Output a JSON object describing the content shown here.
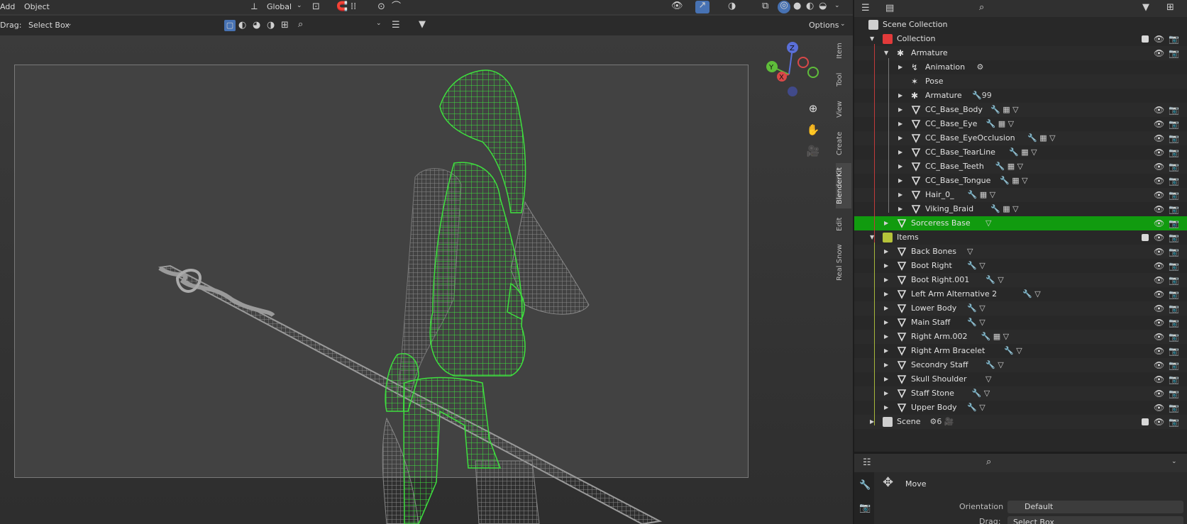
{
  "viewport": {
    "menu": [
      "Add",
      "Object"
    ],
    "orientation": "Global",
    "drag_label": "Drag:",
    "select_mode": "Select Box",
    "options_label": "Options",
    "side_tabs": [
      "Item",
      "Tool",
      "View",
      "Create",
      "BlenderKit",
      "Edit",
      "Real Snow"
    ],
    "active_side_tab": "BlenderKit",
    "gizmo": {
      "x": "X",
      "y": "Y",
      "z": "Z"
    }
  },
  "outliner": {
    "scene_collection": "Scene Collection",
    "rows": [
      {
        "label": "Collection",
        "type": "collection",
        "indent": 1,
        "expanded": true,
        "check": true,
        "eye": true,
        "cam": true,
        "color": "#e23a3a"
      },
      {
        "label": "Armature",
        "type": "armature",
        "indent": 2,
        "expanded": true,
        "eye": true,
        "cam": true
      },
      {
        "label": "Animation",
        "type": "anim",
        "indent": 3,
        "collapsed": true,
        "extra": "⚙"
      },
      {
        "label": "Pose",
        "type": "pose",
        "indent": 3
      },
      {
        "label": "Armature",
        "type": "bone",
        "indent": 3,
        "collapsed": true,
        "extra": "🔧99"
      },
      {
        "label": "CC_Base_Body",
        "type": "mesh",
        "indent": 3,
        "collapsed": true,
        "extra": "🔧 ▦ ▽",
        "eye": true,
        "cam": true
      },
      {
        "label": "CC_Base_Eye",
        "type": "mesh",
        "indent": 3,
        "collapsed": true,
        "extra": "🔧 ▦ ▽",
        "eye": true,
        "cam": true
      },
      {
        "label": "CC_Base_EyeOcclusion",
        "type": "mesh",
        "indent": 3,
        "collapsed": true,
        "extra": "🔧 ▦ ▽",
        "eye": true,
        "cam": true
      },
      {
        "label": "CC_Base_TearLine",
        "type": "mesh",
        "indent": 3,
        "collapsed": true,
        "extra": "🔧 ▦ ▽",
        "eye": true,
        "cam": true
      },
      {
        "label": "CC_Base_Teeth",
        "type": "mesh",
        "indent": 3,
        "collapsed": true,
        "extra": "🔧 ▦ ▽",
        "eye": true,
        "cam": true
      },
      {
        "label": "CC_Base_Tongue",
        "type": "mesh",
        "indent": 3,
        "collapsed": true,
        "extra": "🔧 ▦ ▽",
        "eye": true,
        "cam": true
      },
      {
        "label": "Hair_0_",
        "type": "mesh",
        "indent": 3,
        "collapsed": true,
        "extra": "🔧 ▦ ▽",
        "eye": true,
        "cam": true
      },
      {
        "label": "Viking_Braid",
        "type": "mesh",
        "indent": 3,
        "collapsed": true,
        "extra": "🔧 ▦ ▽",
        "eye": true,
        "cam": true
      },
      {
        "label": "Sorceress Base",
        "type": "mesh",
        "indent": 2,
        "collapsed": true,
        "extra": "▽",
        "eye": true,
        "cam": true,
        "selected": true
      },
      {
        "label": "Items",
        "type": "collection",
        "indent": 1,
        "expanded": true,
        "check": true,
        "eye": true,
        "cam": true,
        "color": "#b6c33a"
      },
      {
        "label": "Back Bones",
        "type": "mesh",
        "indent": 2,
        "collapsed": true,
        "extra": "▽",
        "eye": true,
        "cam": true
      },
      {
        "label": "Boot Right",
        "type": "mesh",
        "indent": 2,
        "collapsed": true,
        "extra": "🔧 ▽",
        "eye": true,
        "cam": true
      },
      {
        "label": "Boot Right.001",
        "type": "mesh",
        "indent": 2,
        "collapsed": true,
        "extra": "🔧 ▽",
        "eye": true,
        "cam": true
      },
      {
        "label": "Left Arm Alternative 2",
        "type": "mesh",
        "indent": 2,
        "collapsed": true,
        "extra": "🔧 ▽",
        "eye": true,
        "cam": true
      },
      {
        "label": "Lower Body",
        "type": "mesh",
        "indent": 2,
        "collapsed": true,
        "extra": "🔧 ▽",
        "eye": true,
        "cam": true
      },
      {
        "label": "Main Staff",
        "type": "mesh",
        "indent": 2,
        "collapsed": true,
        "extra": "🔧 ▽",
        "eye": true,
        "cam": true
      },
      {
        "label": "Right Arm.002",
        "type": "mesh",
        "indent": 2,
        "collapsed": true,
        "extra": "🔧 ▦ ▽",
        "eye": true,
        "cam": true
      },
      {
        "label": "Right Arm Bracelet",
        "type": "mesh",
        "indent": 2,
        "collapsed": true,
        "extra": "🔧 ▽",
        "eye": true,
        "cam": true
      },
      {
        "label": "Secondry Staff",
        "type": "mesh",
        "indent": 2,
        "collapsed": true,
        "extra": "🔧 ▽",
        "eye": true,
        "cam": true
      },
      {
        "label": "Skull Shoulder",
        "type": "mesh",
        "indent": 2,
        "collapsed": true,
        "extra": "▽",
        "eye": true,
        "cam": true
      },
      {
        "label": "Staff Stone",
        "type": "mesh",
        "indent": 2,
        "collapsed": true,
        "extra": "🔧 ▽",
        "eye": true,
        "cam": true
      },
      {
        "label": "Upper Body",
        "type": "mesh",
        "indent": 2,
        "collapsed": true,
        "extra": "🔧 ▽",
        "eye": true,
        "cam": true
      },
      {
        "label": "Scene",
        "type": "collection",
        "indent": 1,
        "collapsed": true,
        "check": true,
        "eye": true,
        "cam": true,
        "extra": "⚙6 🎥",
        "color": "#cfcfcf"
      }
    ]
  },
  "properties": {
    "tool_name": "Move",
    "orientation_label": "Orientation",
    "orientation_value": "Default",
    "drag_label": "Drag:",
    "drag_value": "Select Box"
  },
  "colors": {
    "selection": "#119b0f",
    "wire_active": "#38e038",
    "wire_inactive": "#8a8a8a"
  }
}
